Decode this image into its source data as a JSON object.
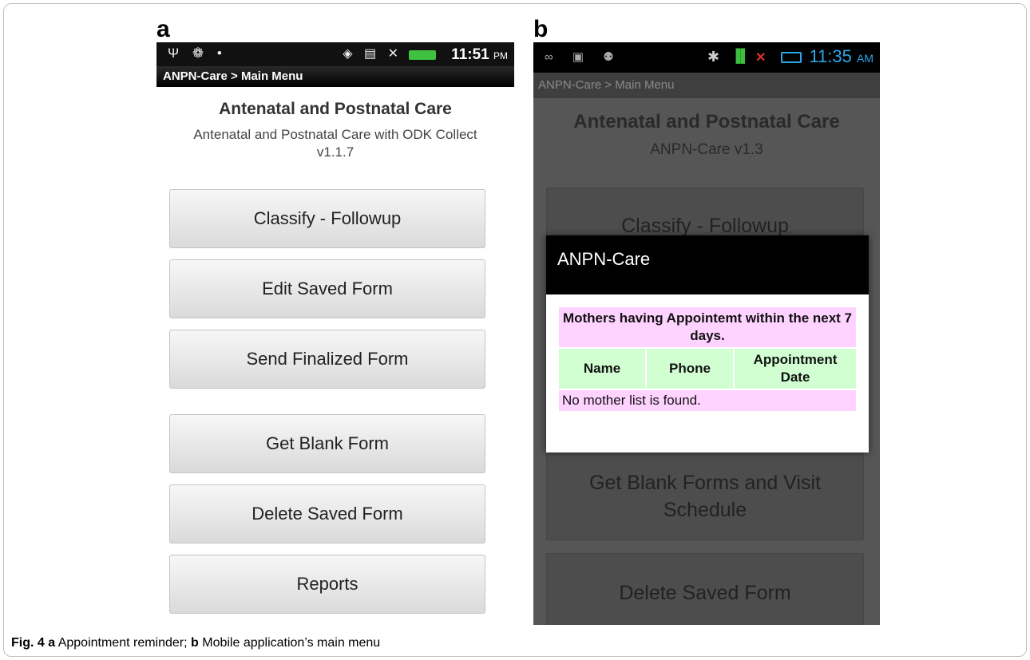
{
  "figure": {
    "panel_a_letter": "a",
    "panel_b_letter": "b",
    "caption_label": "Fig. 4",
    "caption_a_letter": "a",
    "caption_a_text": " Appointment reminder; ",
    "caption_b_letter": "b",
    "caption_b_text": " Mobile application’s main menu"
  },
  "panel_a": {
    "status": {
      "left_icons": "Ψ ❁ •",
      "right_icons": "◈ ▤ ✕",
      "time": "11:51",
      "ampm": "PM"
    },
    "breadcrumb": "ANPN-Care > Main Menu",
    "heading": "Antenatal and Postnatal Care",
    "subtitle_line1": "Antenatal and Postnatal Care with ODK Collect",
    "subtitle_line2": "v1.1.7",
    "buttons": [
      "Classify - Followup",
      "Edit Saved Form",
      "Send Finalized Form",
      "Get Blank Form",
      "Delete Saved Form",
      "Reports"
    ]
  },
  "panel_b": {
    "status": {
      "left_icons": "∞ ▣ ⚉",
      "bluetooth": "✱",
      "signal": "▐▌",
      "nosignal": "✕",
      "time": "11:35",
      "ampm": "AM"
    },
    "breadcrumb": "ANPN-Care > Main Menu",
    "heading": "Antenatal and Postnatal Care",
    "subtitle": "ANPN-Care v1.3",
    "buttons": [
      "Classify - Followup",
      "Get Blank Forms and Visit Schedule",
      "Delete Saved Form"
    ],
    "dialog": {
      "title": "ANPN-Care",
      "table_caption": "Mothers having Appointemt within the next 7 days.",
      "columns": [
        "Name",
        "Phone",
        "Appointment Date"
      ],
      "empty_message": "No mother list is found."
    }
  },
  "colors": {
    "dialog_caption_bg": "#ffd3ff",
    "dialog_header_bg": "#d1ffd1",
    "status_time_b": "#2aa7e8",
    "signal_green": "#3fbf3f",
    "no_signal_red": "#e03030"
  }
}
